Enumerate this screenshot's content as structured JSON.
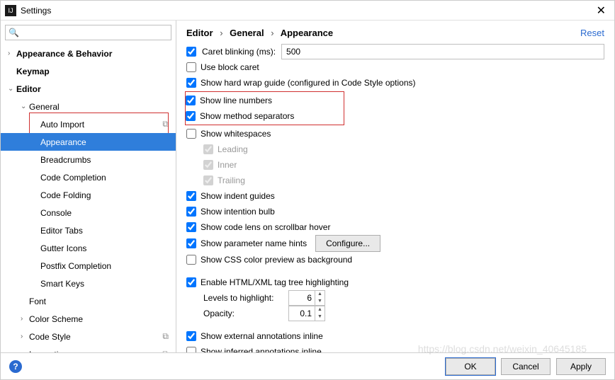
{
  "titlebar": {
    "title": "Settings",
    "app_icon_text": "IJ"
  },
  "search": {
    "placeholder": ""
  },
  "tree": {
    "appearance_behavior": "Appearance & Behavior",
    "keymap": "Keymap",
    "editor": "Editor",
    "general": "General",
    "auto_import": "Auto Import",
    "appearance": "Appearance",
    "breadcrumbs": "Breadcrumbs",
    "code_completion": "Code Completion",
    "code_folding": "Code Folding",
    "console": "Console",
    "editor_tabs": "Editor Tabs",
    "gutter_icons": "Gutter Icons",
    "postfix_completion": "Postfix Completion",
    "smart_keys": "Smart Keys",
    "font": "Font",
    "color_scheme": "Color Scheme",
    "code_style": "Code Style",
    "inspections": "Inspections"
  },
  "breadcrumb": {
    "a": "Editor",
    "b": "General",
    "c": "Appearance",
    "sep": "›"
  },
  "reset": "Reset",
  "options": {
    "caret_blinking": {
      "label": "Caret blinking (ms):",
      "value": "500",
      "checked": true
    },
    "use_block_caret": {
      "label": "Use block caret",
      "checked": false
    },
    "hard_wrap": {
      "label": "Show hard wrap guide (configured in Code Style options)",
      "checked": true
    },
    "line_numbers": {
      "label": "Show line numbers",
      "checked": true
    },
    "method_separators": {
      "label": "Show method separators",
      "checked": true
    },
    "whitespaces": {
      "label": "Show whitespaces",
      "checked": false
    },
    "leading": {
      "label": "Leading",
      "checked": true
    },
    "inner": {
      "label": "Inner",
      "checked": true
    },
    "trailing": {
      "label": "Trailing",
      "checked": true
    },
    "indent_guides": {
      "label": "Show indent guides",
      "checked": true
    },
    "intention_bulb": {
      "label": "Show intention bulb",
      "checked": true
    },
    "code_lens": {
      "label": "Show code lens on scrollbar hover",
      "checked": true
    },
    "param_hints": {
      "label": "Show parameter name hints",
      "checked": true,
      "button": "Configure..."
    },
    "css_preview": {
      "label": "Show CSS color preview as background",
      "checked": false
    },
    "tag_highlight": {
      "label": "Enable HTML/XML tag tree highlighting",
      "checked": true
    },
    "levels": {
      "label": "Levels to highlight:",
      "value": "6"
    },
    "opacity": {
      "label": "Opacity:",
      "value": "0.1"
    },
    "ext_annotations": {
      "label": "Show external annotations inline",
      "checked": true
    },
    "inferred_annotations": {
      "label": "Show inferred annotations inline",
      "checked": false
    }
  },
  "footer": {
    "ok": "OK",
    "cancel": "Cancel",
    "apply": "Apply"
  },
  "watermark": "https://blog.csdn.net/weixin_40645185"
}
